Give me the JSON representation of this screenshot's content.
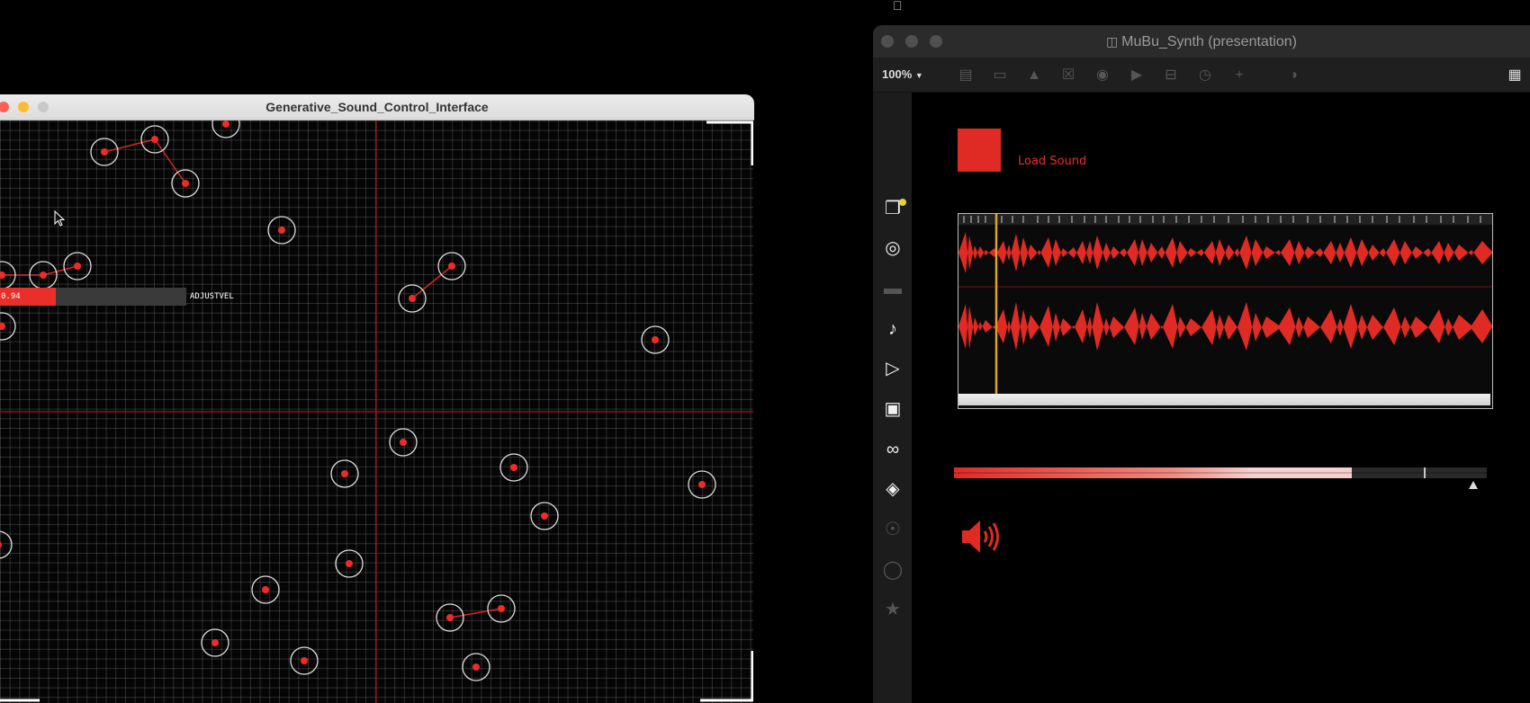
{
  "left_window": {
    "title": "Generative_Sound_Control_Interface",
    "slider": {
      "value_text": "0.94",
      "label": "ADJUSTVEL"
    }
  },
  "right_window": {
    "title": "MuBu_Synth (presentation)",
    "zoom": "100%",
    "load_label": "Load Sound"
  },
  "colors": {
    "accent_red": "#e8302a",
    "grid_line": "#8b1a1a",
    "cursor_line": "#e0a030"
  },
  "icons": {
    "toolbar": [
      "object-list-icon",
      "message-icon",
      "comment-icon",
      "toggle-icon",
      "button-icon",
      "play-icon",
      "slider-icon",
      "dial-icon",
      "add-icon",
      "paint-bucket-icon",
      "grid-icon"
    ],
    "sidebar": [
      "package-icon",
      "target-icon",
      "console-icon",
      "music-note-icon",
      "media-icon",
      "image-icon",
      "paperclip-icon",
      "plugin-icon",
      "vimeo-icon",
      "b-icon",
      "star-icon"
    ]
  }
}
